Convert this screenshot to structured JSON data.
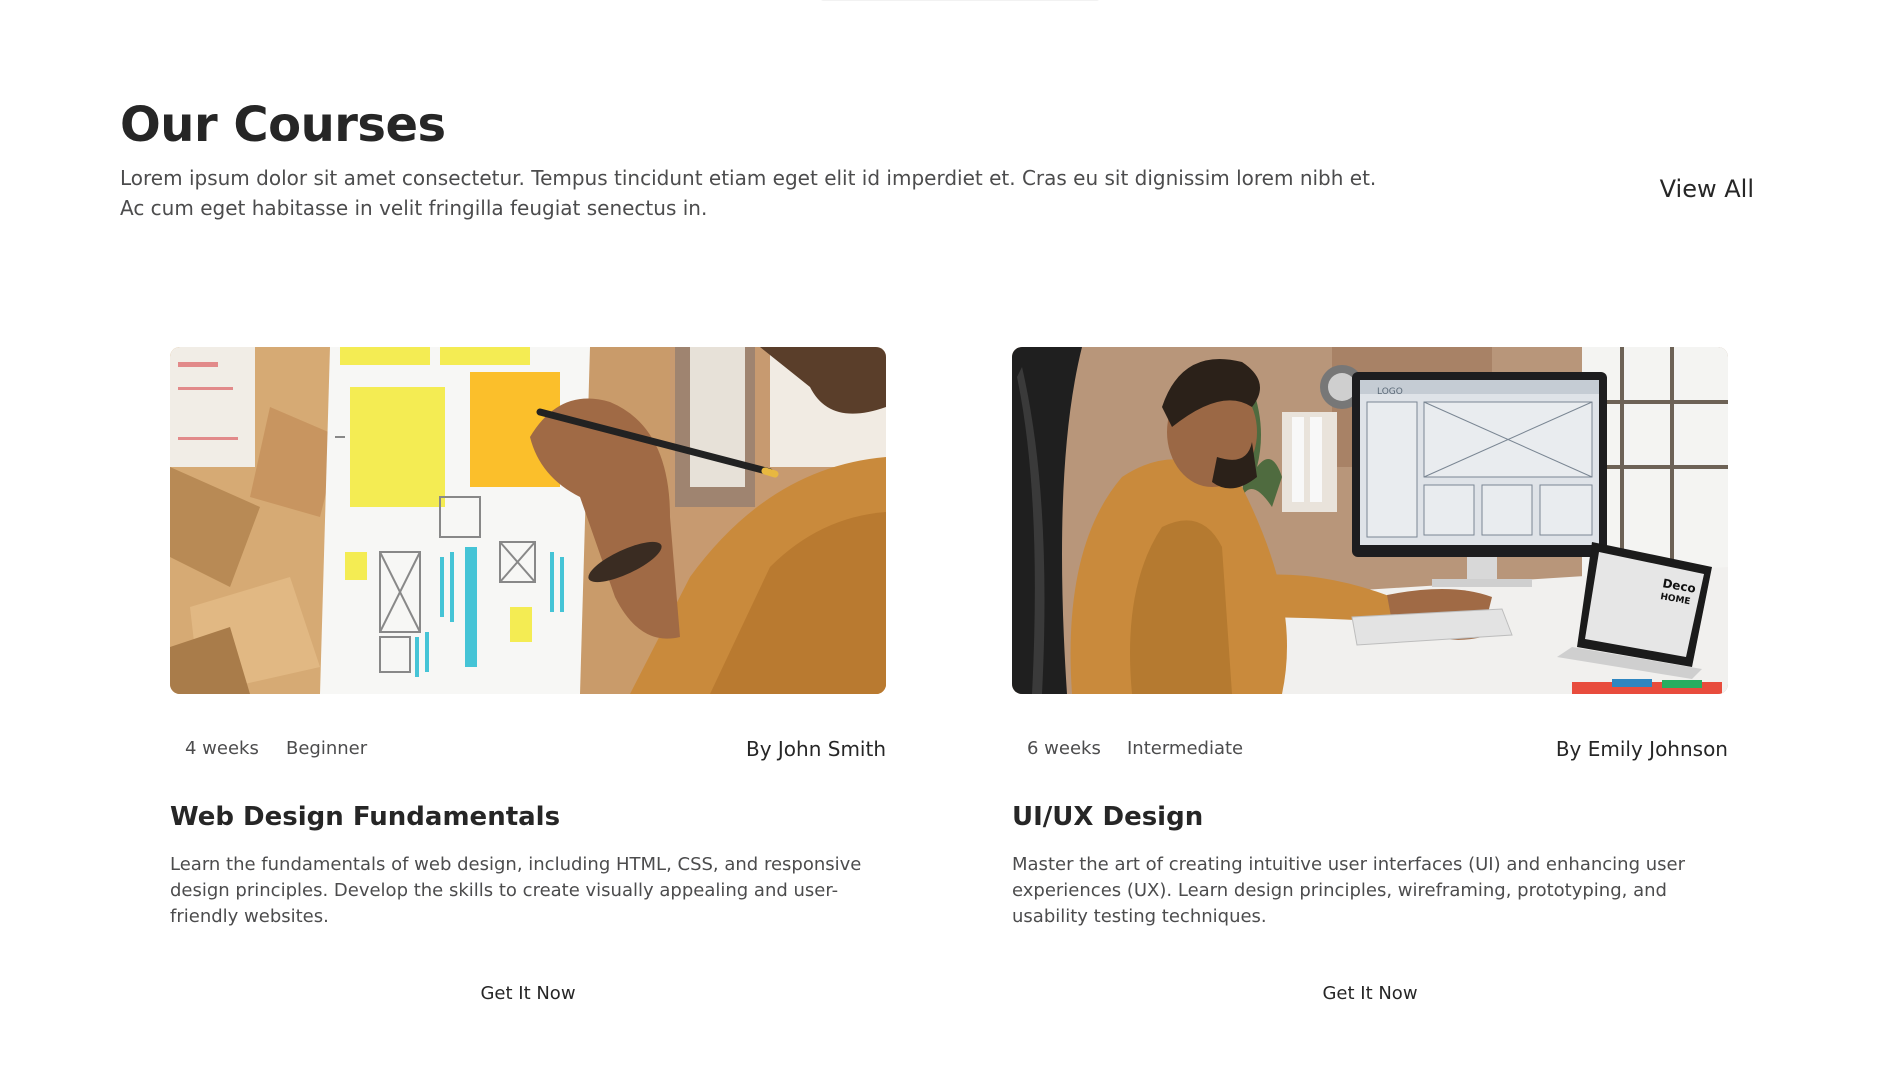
{
  "section": {
    "title": "Our Courses",
    "description": "Lorem ipsum dolor sit amet consectetur. Tempus tincidunt etiam eget elit id imperdiet et. Cras eu sit dignissim lorem nibh et. Ac cum eget habitasse in velit fringilla feugiat senectus in.",
    "view_all_label": "View All"
  },
  "courses": [
    {
      "duration": "4 weeks",
      "level": "Beginner",
      "author": "By John Smith",
      "title": "Web Design Fundamentals",
      "description": "Learn the fundamentals of web design, including HTML, CSS, and responsive design principles. Develop the skills to create visually appealing and user-friendly websites.",
      "cta_label": "Get It Now"
    },
    {
      "duration": "6 weeks",
      "level": "Intermediate",
      "author": "By Emily Johnson",
      "title": "UI/UX Design",
      "description": "Master the art of creating intuitive user interfaces (UI) and enhancing user experiences (UX). Learn design principles, wireframing, prototyping, and usability testing techniques.",
      "cta_label": "Get It Now"
    }
  ],
  "images": {
    "monitor_logo": "LOGO",
    "laptop_brand_line1": "Deco",
    "laptop_brand_line2": "HOME"
  },
  "colors": {
    "text_primary": "#262626",
    "text_secondary": "#4c4c4d",
    "mustard": "#c98a3c",
    "sticky_yellow": "#f4ec53",
    "sticky_orange": "#fbbf2b",
    "cyan": "#45c4d6"
  }
}
